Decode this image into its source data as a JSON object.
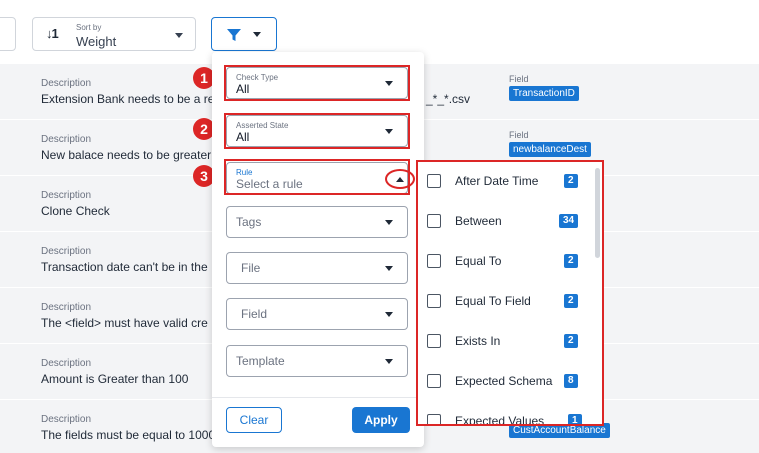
{
  "toolbar": {
    "sort_small_label": "Sort by",
    "sort_value": "Weight",
    "sort_icon": "sort-number-icon",
    "filter_icon": "funnel-icon"
  },
  "list_rows": [
    {
      "desc_label": "Description",
      "desc_text": "Extension Bank needs to be a rep",
      "field_label": "Field",
      "field_value": "TransactionID"
    },
    {
      "desc_label": "Description",
      "desc_text": "New balace needs to be greater",
      "field_label": "Field",
      "field_value": "newbalanceDest"
    },
    {
      "desc_label": "Description",
      "desc_text": "Clone Check",
      "field_label": "",
      "field_value": ""
    },
    {
      "desc_label": "Description",
      "desc_text": "Transaction date can't be in the",
      "field_label": "",
      "field_value": ""
    },
    {
      "desc_label": "Description",
      "desc_text": "The <field> must have valid cre",
      "field_label": "",
      "field_value": ""
    },
    {
      "desc_label": "Description",
      "desc_text": "Amount is Greater than 100",
      "field_label": "",
      "field_value": ""
    },
    {
      "desc_label": "Description",
      "desc_text": "The fields must be equal to 1000",
      "field_label": "",
      "field_value": "CustAccountBalance"
    }
  ],
  "row1_extra": "_*_*.csv",
  "filter_panel": {
    "check_type": {
      "label": "Check Type",
      "value": "All"
    },
    "asserted_state": {
      "label": "Asserted State",
      "value": "All"
    },
    "rule": {
      "label": "Rule",
      "placeholder": "Select a rule"
    },
    "tags": {
      "placeholder": "Tags"
    },
    "file": {
      "placeholder": "File"
    },
    "field": {
      "placeholder": "Field"
    },
    "template": {
      "placeholder": "Template"
    },
    "clear_label": "Clear",
    "apply_label": "Apply"
  },
  "callouts": [
    "1",
    "2",
    "3"
  ],
  "rule_options": [
    {
      "label": "After Date Time",
      "count": "2"
    },
    {
      "label": "Between",
      "count": "34"
    },
    {
      "label": "Equal To",
      "count": "2"
    },
    {
      "label": "Equal To Field",
      "count": "2"
    },
    {
      "label": "Exists In",
      "count": "2"
    },
    {
      "label": "Expected Schema",
      "count": "8"
    },
    {
      "label": "Expected Values",
      "count": "1"
    }
  ],
  "colors": {
    "accent": "#1976d2",
    "highlight": "#dc2626"
  }
}
